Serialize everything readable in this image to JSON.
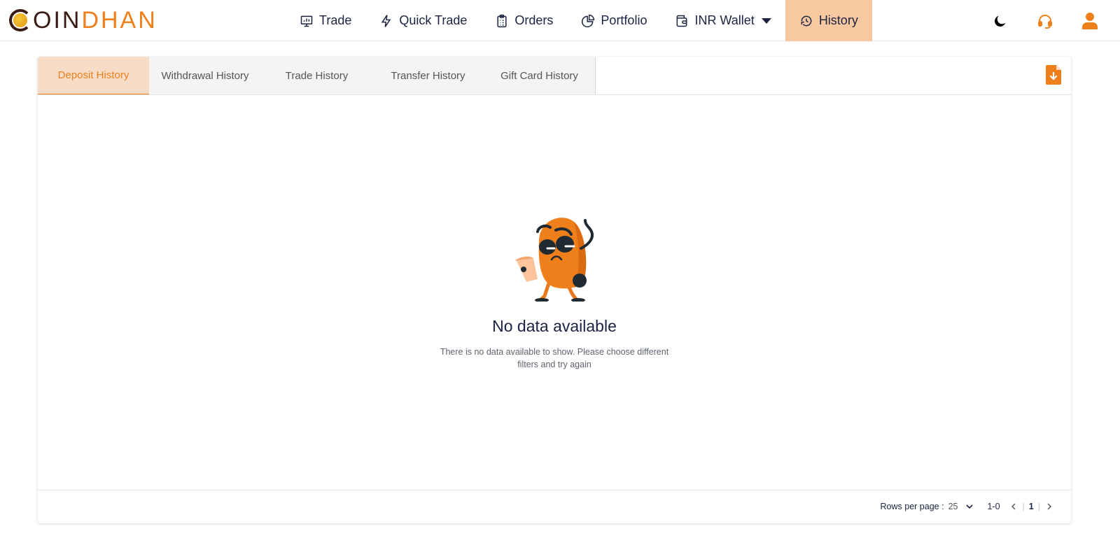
{
  "brand": {
    "part1": "OIN",
    "part2": "DHAN",
    "accent": "#ef7f1a",
    "dark": "#3a1d12"
  },
  "nav": {
    "items": [
      {
        "label": "Trade",
        "icon": "monitor-chart-icon"
      },
      {
        "label": "Quick Trade",
        "icon": "lightning-icon"
      },
      {
        "label": "Orders",
        "icon": "clipboard-icon"
      },
      {
        "label": "Portfolio",
        "icon": "pie-chart-icon"
      },
      {
        "label": "INR Wallet",
        "icon": "wallet-icon",
        "dropdown": true
      },
      {
        "label": "History",
        "icon": "history-icon",
        "active": true
      }
    ]
  },
  "header_icons": [
    "moon-icon",
    "headset-icon",
    "user-icon"
  ],
  "tabs": [
    {
      "label": "Deposit History",
      "active": true
    },
    {
      "label": "Withdrawal History"
    },
    {
      "label": "Trade History"
    },
    {
      "label": "Transfer History"
    },
    {
      "label": "Gift Card History"
    }
  ],
  "empty_state": {
    "title": "No data available",
    "description": "There is no data available to show. Please choose different filters and try again"
  },
  "pagination": {
    "rows_per_page_label": "Rows per page :",
    "rows_per_page_value": "25",
    "range": "1-0",
    "current_page": "1"
  }
}
